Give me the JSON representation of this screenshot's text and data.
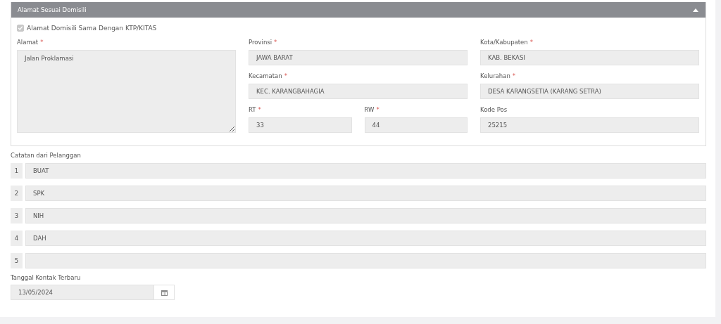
{
  "panel": {
    "title": "Alamat Sesuai Domisili",
    "expanded": true,
    "checkbox": {
      "label": "Alamat Domisili Sama Dengan KTP/KITAS",
      "checked": true,
      "disabled": true
    },
    "address": {
      "label": "Alamat",
      "required_mark": "*",
      "value": "Jalan Proklamasi"
    },
    "fields": [
      {
        "label": "Provinsi",
        "required_mark": "*",
        "value": "JAWA BARAT"
      },
      {
        "label": "Kota/Kabupaten",
        "required_mark": "*",
        "value": "KAB. BEKASI"
      },
      {
        "label": "Kecamatan",
        "required_mark": "*",
        "value": "KEC. KARANGBAHAGIA"
      },
      {
        "label": "Kelurahan",
        "required_mark": "*",
        "value": "DESA KARANGSETIA (KARANG SETRA)"
      },
      {
        "label": "RT",
        "required_mark": "*",
        "value": "33"
      },
      {
        "label": "RW",
        "required_mark": "*",
        "value": "44"
      },
      {
        "label": "Kode Pos",
        "value": "25215"
      }
    ]
  },
  "notes": {
    "label": "Catatan dari Pelanggan",
    "items": [
      {
        "number": "1",
        "value": "BUAT"
      },
      {
        "number": "2",
        "value": "SPK"
      },
      {
        "number": "3",
        "value": "NIH"
      },
      {
        "number": "4",
        "value": "DAH"
      },
      {
        "number": "5",
        "value": ""
      }
    ]
  },
  "contact_date": {
    "label": "Tanggal Kontak Terbaru",
    "value": "13/05/2024"
  }
}
